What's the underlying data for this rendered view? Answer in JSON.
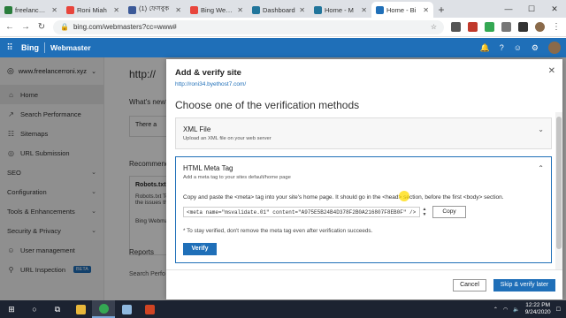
{
  "browser": {
    "tabs": [
      {
        "title": "freelancerroni",
        "color": "#2a7d3c"
      },
      {
        "title": "Roni Miah",
        "color": "#e8453c"
      },
      {
        "title": "(1) ফেসবুক",
        "color": "#3b5998"
      },
      {
        "title": "Bing Webm",
        "color": "#e8453c"
      },
      {
        "title": "Dashboard",
        "color": "#21759b"
      },
      {
        "title": "Home - M",
        "color": "#21759b"
      },
      {
        "title": "Home - Bi",
        "color": "#1f6fb8"
      }
    ],
    "url": "bing.com/webmasters?cc=www#"
  },
  "header": {
    "brand": "Bing",
    "product": "Webmaster"
  },
  "sidebar": {
    "site": "www.freelancerroni.xyz",
    "items": [
      {
        "label": "Home",
        "icon": "home-icon",
        "glyph": "⌂"
      },
      {
        "label": "Search Performance",
        "icon": "chart-icon",
        "glyph": "↗"
      },
      {
        "label": "Sitemaps",
        "icon": "sitemap-icon",
        "glyph": "☷"
      },
      {
        "label": "URL Submission",
        "icon": "globe-icon",
        "glyph": "◎"
      },
      {
        "label": "SEO",
        "icon": "",
        "glyph": ""
      },
      {
        "label": "Configuration",
        "icon": "",
        "glyph": ""
      },
      {
        "label": "Tools & Enhancements",
        "icon": "",
        "glyph": ""
      },
      {
        "label": "Security & Privacy",
        "icon": "",
        "glyph": ""
      },
      {
        "label": "User management",
        "icon": "user-icon",
        "glyph": "☺"
      },
      {
        "label": "URL Inspection",
        "icon": "search-icon",
        "glyph": "⚲"
      }
    ],
    "beta": "BETA"
  },
  "main": {
    "site_url": "http://",
    "whats_new": "What's new?",
    "card_text": "There a",
    "recommend": "Recommende",
    "rec_card_title": "Robots.txt",
    "rec_card_text": "Robots.txt Tes the issues the",
    "rec_card_footer": "Bing Webmas",
    "reports": "Reports",
    "search_perf": "Search Perfo"
  },
  "dialog": {
    "title": "Add & verify site",
    "site_url": "http://roni34.byethost7.com/",
    "heading": "Choose one of the verification methods",
    "xml": {
      "title": "XML File",
      "subtitle": "Upload an XML file on your web server"
    },
    "meta": {
      "title": "HTML Meta Tag",
      "subtitle": "Add a meta tag to your sites default/home page",
      "instructions": "Copy and paste the <meta> tag into your site's home page. It should go in the <head> section, before the first <body> section.",
      "tag": "<meta name=\"msvalidate.01\" content=\"A975E5B24B4D378F2B0A216807F8EB0F\" />",
      "copy": "Copy",
      "note": "* To stay verified, don't remove the meta tag even after verification succeeds.",
      "verify": "Verify"
    },
    "cancel": "Cancel",
    "skip": "Skip & verify later"
  },
  "taskbar": {
    "time": "12:22 PM",
    "date": "9/24/2020"
  }
}
